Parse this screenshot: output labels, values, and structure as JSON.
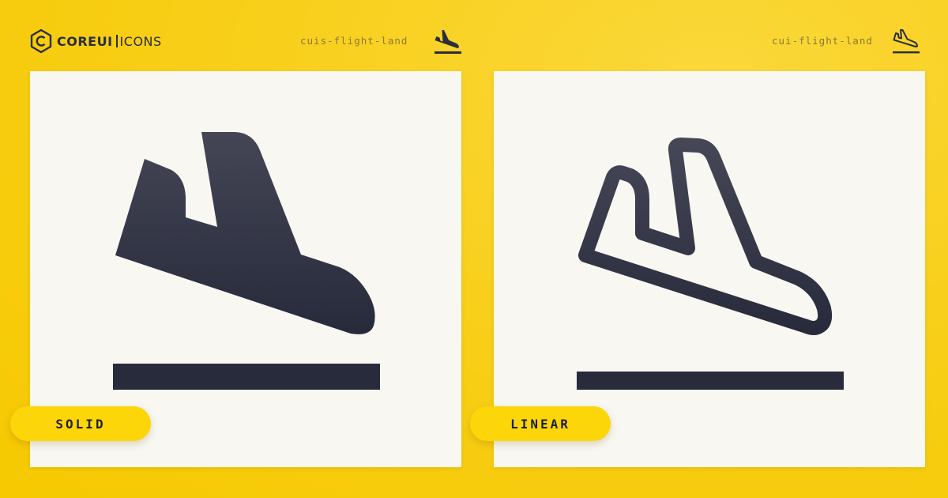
{
  "brand": {
    "name_bold": "COREUI",
    "name_light": "ICONS",
    "logo_icon": "hexagon-c-logo-icon"
  },
  "variants": [
    {
      "icon_name": "cuis-flight-land",
      "style_label": "SOLID",
      "icon": "flight-land-solid-icon"
    },
    {
      "icon_name": "cui-flight-land",
      "style_label": "LINEAR",
      "icon": "flight-land-linear-icon"
    }
  ],
  "colors": {
    "background": "#f8cf1a",
    "card": "#f8f7f2",
    "icon": "#2b2d3e",
    "pill": "#fcd608"
  }
}
